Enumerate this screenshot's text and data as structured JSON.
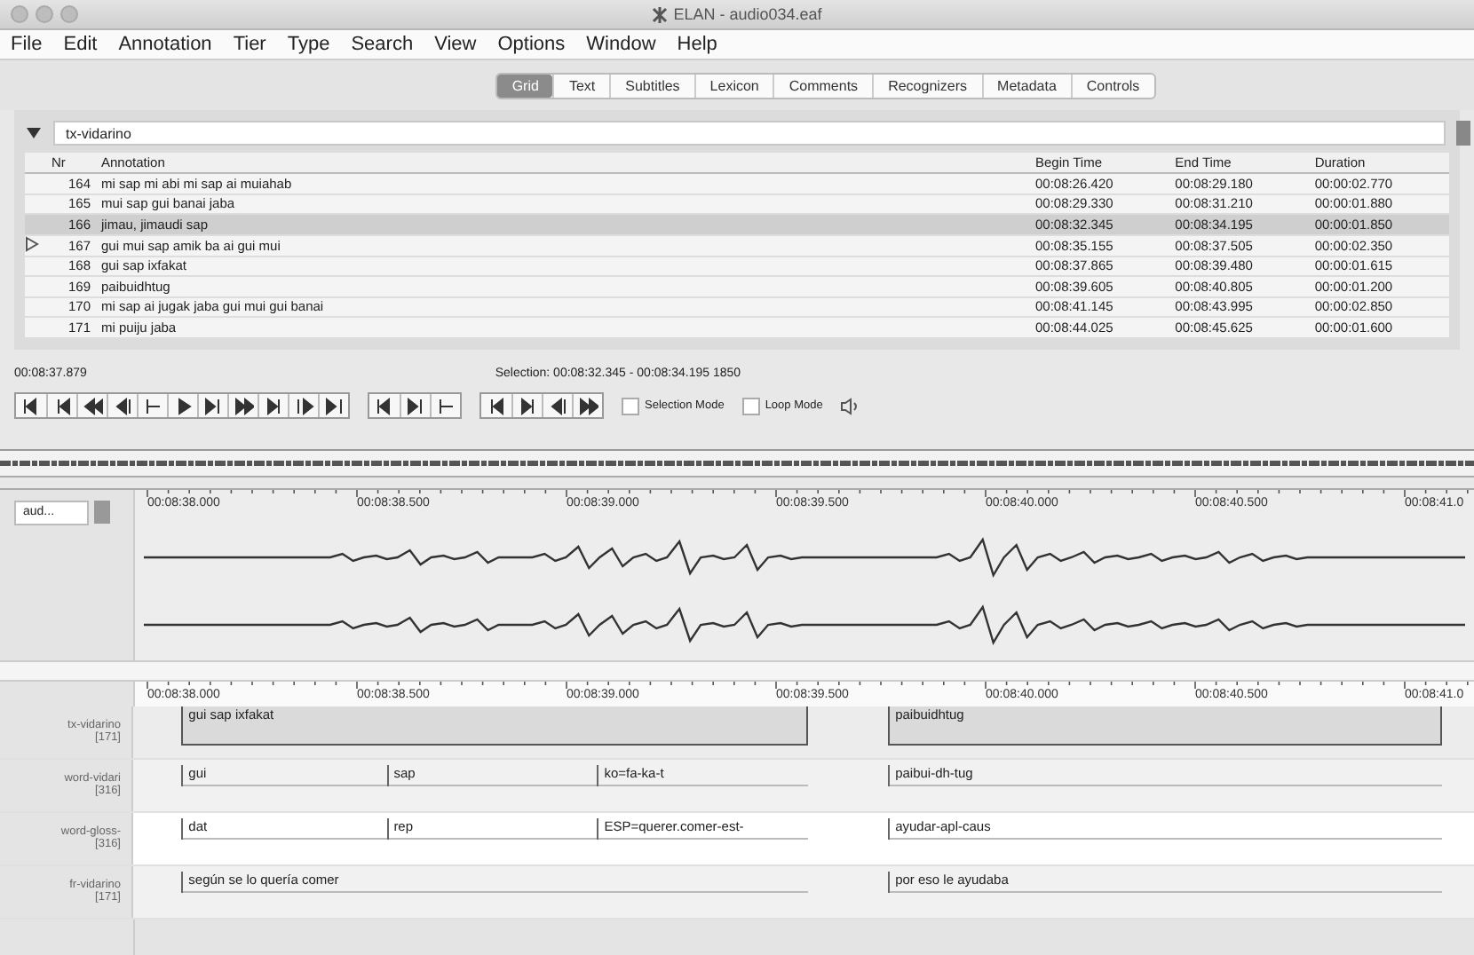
{
  "window": {
    "title": "ELAN - audio034.eaf"
  },
  "menu": [
    "File",
    "Edit",
    "Annotation",
    "Tier",
    "Type",
    "Search",
    "View",
    "Options",
    "Window",
    "Help"
  ],
  "tabs": [
    {
      "label": "Grid",
      "selected": true
    },
    {
      "label": "Text",
      "selected": false
    },
    {
      "label": "Subtitles",
      "selected": false
    },
    {
      "label": "Lexicon",
      "selected": false
    },
    {
      "label": "Comments",
      "selected": false
    },
    {
      "label": "Recognizers",
      "selected": false
    },
    {
      "label": "Metadata",
      "selected": false
    },
    {
      "label": "Controls",
      "selected": false
    }
  ],
  "grid": {
    "tier": "tx-vidarino",
    "columns": [
      "Nr",
      "Annotation",
      "Begin Time",
      "End Time",
      "Duration"
    ],
    "rows": [
      {
        "nr": "164",
        "annotation": "mi sap mi abi mi sap ai muiahab",
        "begin": "00:08:26.420",
        "end": "00:08:29.180",
        "duration": "00:00:02.770",
        "selected": false,
        "current": false
      },
      {
        "nr": "165",
        "annotation": "mui sap gui banai jaba",
        "begin": "00:08:29.330",
        "end": "00:08:31.210",
        "duration": "00:00:01.880",
        "selected": false,
        "current": false
      },
      {
        "nr": "166",
        "annotation": "jimau, jimaudi sap",
        "begin": "00:08:32.345",
        "end": "00:08:34.195",
        "duration": "00:00:01.850",
        "selected": true,
        "current": false
      },
      {
        "nr": "167",
        "annotation": "gui mui sap amik ba ai gui mui",
        "begin": "00:08:35.155",
        "end": "00:08:37.505",
        "duration": "00:00:02.350",
        "selected": false,
        "current": true
      },
      {
        "nr": "168",
        "annotation": "gui sap ixfakat",
        "begin": "00:08:37.865",
        "end": "00:08:39.480",
        "duration": "00:00:01.615",
        "selected": false,
        "current": false
      },
      {
        "nr": "169",
        "annotation": "paibuidhtug",
        "begin": "00:08:39.605",
        "end": "00:08:40.805",
        "duration": "00:00:01.200",
        "selected": false,
        "current": false
      },
      {
        "nr": "170",
        "annotation": "mi sap ai jugak jaba gui mui gui banai",
        "begin": "00:08:41.145",
        "end": "00:08:43.995",
        "duration": "00:00:02.850",
        "selected": false,
        "current": false
      },
      {
        "nr": "171",
        "annotation": "mi puiju jaba",
        "begin": "00:08:44.025",
        "end": "00:08:45.625",
        "duration": "00:00:01.600",
        "selected": false,
        "current": false
      }
    ]
  },
  "media_time": "00:08:37.879",
  "selection": "Selection: 00:08:32.345 - 00:08:34.195  1850",
  "options": [
    {
      "label": "Selection Mode",
      "checked": false
    },
    {
      "label": "Loop Mode",
      "checked": false
    }
  ],
  "waveform": {
    "track": "aud..."
  },
  "ruler": [
    "00:08:38.000",
    "00:08:38.500",
    "00:08:39.000",
    "00:08:39.500",
    "00:08:40.000",
    "00:08:40.500",
    "00:08:41.0"
  ],
  "ruler_2": [
    "00:08:38.000",
    "00:08:38.500",
    "00:08:39.000",
    "00:08:39.500",
    "00:08:40.000",
    "00:08:40.500",
    "00:08:41.0"
  ],
  "tiers": [
    {
      "name": "tx-vidarino",
      "count": "[171]",
      "annotations": [
        "gui sap ixfakat",
        "paibuidhtug"
      ]
    },
    {
      "name": "word-vidari",
      "count": "[316]",
      "annotations": [
        "gui",
        "sap",
        "ko=fa-ka-t",
        "paibui-dh-tug"
      ]
    },
    {
      "name": "word-gloss-",
      "count": "[316]",
      "annotations": [
        "dat",
        "rep",
        "ESP=querer.comer-est-",
        "ayudar-apl-caus"
      ]
    },
    {
      "name": "fr-vidarino",
      "count": "[171]",
      "annotations": [
        "según se lo quería comer",
        "por eso le ayudaba"
      ]
    }
  ]
}
